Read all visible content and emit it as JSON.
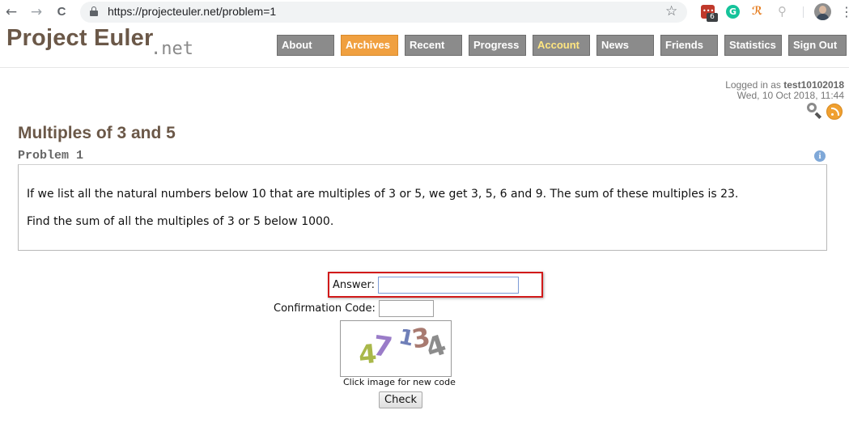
{
  "browser": {
    "url": "https://projecteuler.net/problem=1",
    "back_icon": "←",
    "forward_icon": "→",
    "reload_icon": "C",
    "star_icon": "☆",
    "extension_badge": "6",
    "extension_dots": "•••",
    "grammarly_letter": "G",
    "wand_glyph": "ℛ",
    "search_glyph": "⚲",
    "menu_icon": "⋮"
  },
  "site": {
    "logo_main": "Project Euler",
    "logo_net": ".net",
    "nav": [
      {
        "label": "About"
      },
      {
        "label": "Archives"
      },
      {
        "label": "Recent"
      },
      {
        "label": "Progress"
      },
      {
        "label": "Account"
      },
      {
        "label": "News"
      },
      {
        "label": "Friends"
      },
      {
        "label": "Statistics"
      },
      {
        "label": "Sign Out"
      }
    ],
    "active_nav": "Archives",
    "colors": {
      "brand": "#6b5848",
      "nav_bg": "#8b8b8b",
      "nav_active": "#f0a040",
      "highlight": "#d11a1a"
    }
  },
  "login": {
    "prefix": "Logged in as ",
    "username": "test10102018",
    "datetime": "Wed, 10 Oct 2018, 11:44"
  },
  "problem": {
    "title": "Multiples of 3 and 5",
    "number": "Problem 1",
    "info_icon": "i",
    "paragraph1": "If we list all the natural numbers below 10 that are multiples of 3 or 5, we get 3, 5, 6 and 9. The sum of these multiples is 23.",
    "paragraph2": "Find the sum of all the multiples of 3 or 5 below 1000."
  },
  "form": {
    "answer_label": "Answer:",
    "answer_value": "",
    "confirmation_label": "Confirmation Code:",
    "confirmation_value": "",
    "captcha_chars": [
      "4",
      "7",
      "1",
      "3",
      "4"
    ],
    "captcha_caption": "Click image for new code",
    "check_label": "Check"
  }
}
